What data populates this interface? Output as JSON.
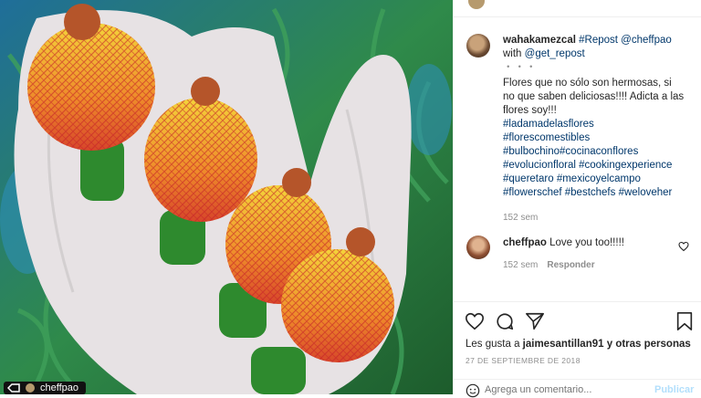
{
  "post": {
    "username": "wahakamezcal",
    "repost_text": "#Repost",
    "repost_user": "@cheffpao",
    "with_text": "with",
    "with_user": "@get_repost",
    "dots": "・・・",
    "caption": "Flores que no sólo son hermosas, si no que saben deliciosas!!!! Adicta a las flores soy!!!",
    "hashtags": [
      "#ladamadelasflores",
      "#florescomestibles",
      "#bulbochino#cocinaconflores",
      "#evolucionfloral #cookingexperience",
      "#queretaro #mexicoyelcampo",
      "#flowerschef #bestchefs #weloveher"
    ],
    "time": "152 sem"
  },
  "comment": {
    "username": "cheffpao",
    "text": "Love you too!!!!!",
    "time": "152 sem",
    "reply": "Responder"
  },
  "actions": {
    "likes_prefix": "Les gusta a",
    "likes_user": "jaimesantillan91",
    "likes_suffix": "y otras personas",
    "date": "27 DE SEPTIEMBRE DE 2018"
  },
  "comment_box": {
    "placeholder": "Agrega un comentario...",
    "publish": "Publicar"
  },
  "photo_tag": {
    "text": "cheffpao"
  },
  "icons": {
    "like": "heart-icon",
    "comment": "comment-icon",
    "share": "paper-plane-icon",
    "save": "bookmark-icon",
    "emoji": "smiley-icon",
    "tag": "tag-icon"
  },
  "colors": {
    "link": "#00376b",
    "muted": "#8e8e8e",
    "publish": "#b2dffc"
  }
}
